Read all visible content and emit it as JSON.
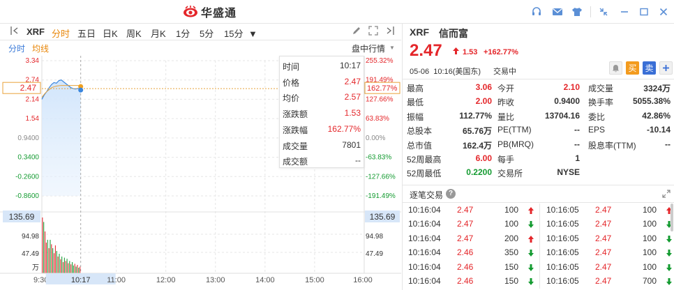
{
  "app": {
    "brand": "华盛通",
    "title_icons": [
      "headset-icon",
      "mail-icon",
      "shirt-icon",
      "eye-icon",
      "shrink-icon",
      "minimize-icon",
      "close-icon"
    ]
  },
  "toolbar": {
    "symbol": "XRF",
    "periods": [
      "分时",
      "五日",
      "日K",
      "周K",
      "月K",
      "1分",
      "5分",
      "15分"
    ],
    "active_period": "分时",
    "dropdown_arrow": "▼"
  },
  "subtoolbar": {
    "tab_fenshi": "分时",
    "tab_junxian": "均线",
    "market_label": "盘中行情",
    "market_arrow": "▼"
  },
  "chart_data": {
    "type": "line",
    "y_left_ticks": [
      "3.34",
      "2.74",
      "2.14",
      "1.54",
      "0.9400",
      "0.3400",
      "-0.2600",
      "-0.8600"
    ],
    "y_right_ticks": [
      "255.32%",
      "191.49%",
      "127.66%",
      "63.83%",
      "0.00%",
      "-63.83%",
      "-127.66%",
      "-191.49%"
    ],
    "current_price_label": "2.47",
    "current_pct_label": "162.77%",
    "volume_ticks": [
      "135.69",
      "94.98",
      "47.49",
      "万"
    ],
    "volume_marker": "135.69",
    "x_ticks": [
      "9:30",
      "10:17",
      "11:00",
      "12:00",
      "13:00",
      "14:00",
      "15:00",
      "16:00"
    ],
    "price_series": [
      2.14,
      2.28,
      2.38,
      2.5,
      2.6,
      2.66,
      2.64,
      2.72,
      2.74,
      2.68,
      2.62,
      2.56,
      2.5,
      2.47,
      2.46,
      2.48,
      2.47
    ],
    "avg_series": [
      2.2,
      2.3,
      2.38,
      2.44,
      2.5,
      2.53,
      2.55,
      2.56,
      2.57,
      2.57,
      2.57,
      2.57,
      2.57,
      2.57,
      2.57,
      2.57,
      2.57
    ],
    "volume_series": [
      1.0,
      0.92,
      0.75,
      0.55,
      0.6,
      0.45,
      0.6,
      0.52,
      0.45,
      0.36,
      0.5,
      0.4,
      0.3,
      0.35,
      0.25,
      0.3,
      0.2,
      0.28,
      0.22,
      0.26,
      0.18,
      0.22,
      0.16,
      0.2,
      0.14,
      0.17,
      0.12,
      0.15,
      0.1,
      0.12
    ],
    "volume_colors": [
      "r",
      "g",
      "r",
      "r",
      "g",
      "r",
      "g",
      "r",
      "g",
      "r",
      "r",
      "g",
      "r",
      "g",
      "r",
      "g",
      "r",
      "g",
      "r",
      "g",
      "r",
      "g",
      "r",
      "g",
      "g",
      "r",
      "g",
      "r",
      "g",
      "r"
    ],
    "ylim": [
      -0.86,
      3.34
    ]
  },
  "tooltip": {
    "rows": [
      {
        "k": "时间",
        "v": "10:17",
        "c": "#333"
      },
      {
        "k": "价格",
        "v": "2.47",
        "c": "#e4262a"
      },
      {
        "k": "均价",
        "v": "2.57",
        "c": "#e4262a"
      },
      {
        "k": "涨跌额",
        "v": "1.53",
        "c": "#e4262a"
      },
      {
        "k": "涨跌幅",
        "v": "162.77%",
        "c": "#e4262a"
      },
      {
        "k": "成交量",
        "v": "7801",
        "c": "#333"
      },
      {
        "k": "成交额",
        "v": "--",
        "c": "#333"
      }
    ]
  },
  "quote": {
    "symbol": "XRF",
    "name": "信而富",
    "price": "2.47",
    "change": "1.53",
    "change_pct": "+162.77%",
    "datetime": "05-06  10:16(美国东)",
    "status": "交易中",
    "buttons": {
      "buy": "买",
      "sell": "卖"
    }
  },
  "stats": {
    "col1": [
      {
        "k": "最高",
        "v": "3.06",
        "c": "#e4262a"
      },
      {
        "k": "最低",
        "v": "2.00",
        "c": "#e4262a"
      },
      {
        "k": "振幅",
        "v": "112.77%",
        "c": "#333"
      },
      {
        "k": "总股本",
        "v": "65.76万",
        "c": "#333"
      },
      {
        "k": "总市值",
        "v": "162.4万",
        "c": "#333"
      },
      {
        "k": "52周最高",
        "v": "6.00",
        "c": "#e4262a"
      },
      {
        "k": "52周最低",
        "v": "0.2200",
        "c": "#149b31"
      }
    ],
    "col2": [
      {
        "k": "今开",
        "v": "2.10",
        "c": "#e4262a"
      },
      {
        "k": "昨收",
        "v": "0.9400",
        "c": "#333"
      },
      {
        "k": "量比",
        "v": "13704.16",
        "c": "#333"
      },
      {
        "k": "PE(TTM)",
        "v": "--",
        "c": "#333"
      },
      {
        "k": "PB(MRQ)",
        "v": "--",
        "c": "#333"
      },
      {
        "k": "每手",
        "v": "1",
        "c": "#333"
      },
      {
        "k": "交易所",
        "v": "NYSE",
        "c": "#333"
      }
    ],
    "col3": [
      {
        "k": "成交量",
        "v": "3324万",
        "c": "#333"
      },
      {
        "k": "换手率",
        "v": "5055.38%",
        "c": "#333"
      },
      {
        "k": "委比",
        "v": "42.86%",
        "c": "#333"
      },
      {
        "k": "EPS",
        "v": "-10.14",
        "c": "#333"
      },
      {
        "k": "股息率(TTM)",
        "v": "--",
        "c": "#333"
      }
    ]
  },
  "trades": {
    "title": "逐笔交易",
    "help": "?",
    "left": [
      {
        "t": "10:16:04",
        "p": "2.47",
        "q": "100",
        "d": "up"
      },
      {
        "t": "10:16:04",
        "p": "2.47",
        "q": "100",
        "d": "down"
      },
      {
        "t": "10:16:04",
        "p": "2.47",
        "q": "200",
        "d": "up"
      },
      {
        "t": "10:16:04",
        "p": "2.46",
        "q": "350",
        "d": "down"
      },
      {
        "t": "10:16:04",
        "p": "2.46",
        "q": "150",
        "d": "down"
      },
      {
        "t": "10:16:04",
        "p": "2.46",
        "q": "150",
        "d": "down"
      }
    ],
    "right": [
      {
        "t": "10:16:05",
        "p": "2.47",
        "q": "100",
        "d": "up"
      },
      {
        "t": "10:16:05",
        "p": "2.47",
        "q": "100",
        "d": "down"
      },
      {
        "t": "10:16:05",
        "p": "2.47",
        "q": "100",
        "d": "down"
      },
      {
        "t": "10:16:05",
        "p": "2.47",
        "q": "100",
        "d": "down"
      },
      {
        "t": "10:16:05",
        "p": "2.47",
        "q": "100",
        "d": "down"
      },
      {
        "t": "10:16:05",
        "p": "2.47",
        "q": "700",
        "d": "down"
      }
    ]
  }
}
